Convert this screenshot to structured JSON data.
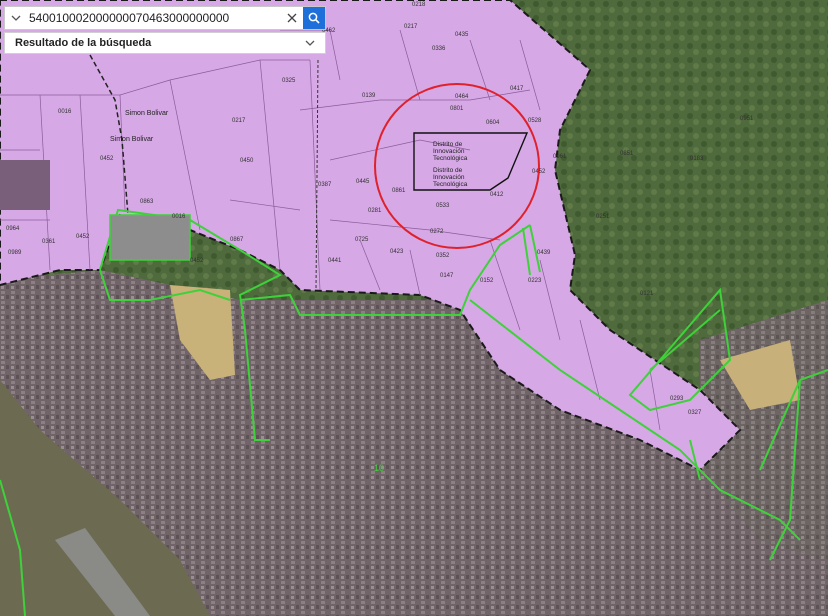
{
  "search": {
    "value": "540010002000000070463000000000",
    "dropdown_icon": "chevron-down-icon",
    "clear_icon": "close-icon",
    "search_icon": "search-icon"
  },
  "results": {
    "label": "Resultado de la búsqueda",
    "chevron_icon": "chevron-down-icon"
  },
  "map": {
    "places": {
      "simon_bolivar_1": "Simon Bolivar",
      "simon_bolivar_2": "Simon Bolivar",
      "district_1": [
        "Distrito de",
        "Innovación",
        "Tecnológica"
      ],
      "district_2": [
        "Distrito de",
        "Innovación",
        "Tecnológica"
      ],
      "zone_number": "10"
    },
    "parcels": [
      "0218",
      "0217",
      "0336",
      "0435",
      "0325",
      "0462",
      "0464",
      "0016",
      "0139",
      "0801",
      "0604",
      "0528",
      "0217",
      "0452",
      "0450",
      "0387",
      "0445",
      "0861",
      "0281",
      "0533",
      "0412",
      "0272",
      "0725",
      "0423",
      "0352",
      "0417",
      "0441",
      "0147",
      "0152",
      "0223",
      "0439",
      "0863",
      "0016",
      "0867",
      "0452",
      "0964",
      "0361",
      "0452",
      "0989",
      "0452",
      "0961",
      "0251",
      "0121",
      "0851",
      "0951",
      "0293",
      "0327",
      "0183"
    ],
    "colors": {
      "municipal_zone": "#d6a8e6",
      "zone_border": "#1a1a1a",
      "green_boundary": "#3ed13a",
      "highlight_circle": "#e0202a",
      "satellite_urban": "#6e6468",
      "satellite_vegetation": "#4f6a3c"
    }
  }
}
